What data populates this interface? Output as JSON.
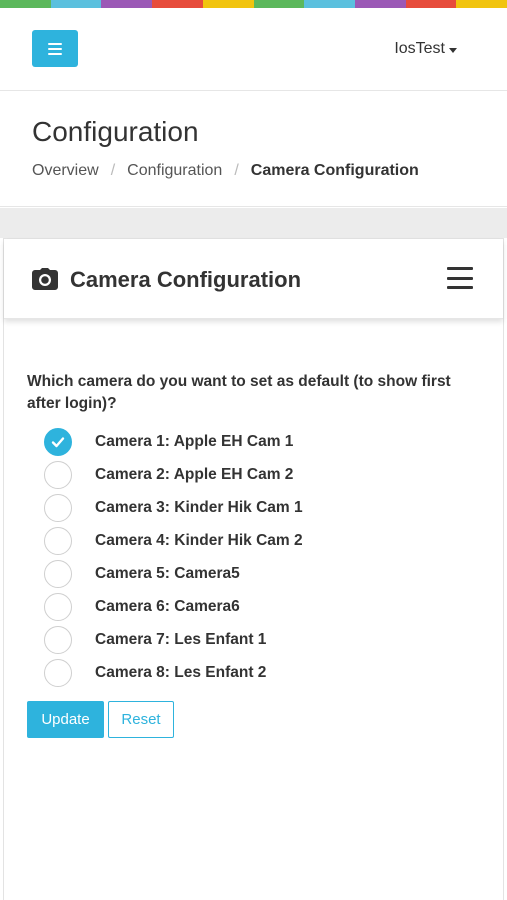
{
  "rainbow_colors": [
    "#5cb85c",
    "#5bc0de",
    "#9b59b6",
    "#e74c3c",
    "#f1c40f",
    "#5cb85c",
    "#5bc0de",
    "#9b59b6",
    "#e74c3c",
    "#f1c40f"
  ],
  "accent_color": "#2eb3dd",
  "topbar": {
    "menu_icon": "hamburger-icon",
    "user_label": "IosTest"
  },
  "page": {
    "title": "Configuration",
    "breadcrumb": [
      "Overview",
      "Configuration",
      "Camera Configuration"
    ]
  },
  "panel": {
    "icon": "camera-icon",
    "title": "Camera Configuration",
    "menu_icon": "hamburger-icon"
  },
  "form": {
    "question": "Which camera do you want to set as default (to show first after login)?",
    "options": [
      {
        "label": "Camera 1: Apple EH Cam 1",
        "checked": true
      },
      {
        "label": "Camera 2: Apple EH Cam 2",
        "checked": false
      },
      {
        "label": "Camera 3: Kinder Hik Cam 1",
        "checked": false
      },
      {
        "label": "Camera 4: Kinder Hik Cam 2",
        "checked": false
      },
      {
        "label": "Camera 5: Camera5",
        "checked": false
      },
      {
        "label": "Camera 6: Camera6",
        "checked": false
      },
      {
        "label": "Camera 7: Les Enfant 1",
        "checked": false
      },
      {
        "label": "Camera 8: Les Enfant 2",
        "checked": false
      }
    ],
    "update_label": "Update",
    "reset_label": "Reset"
  }
}
